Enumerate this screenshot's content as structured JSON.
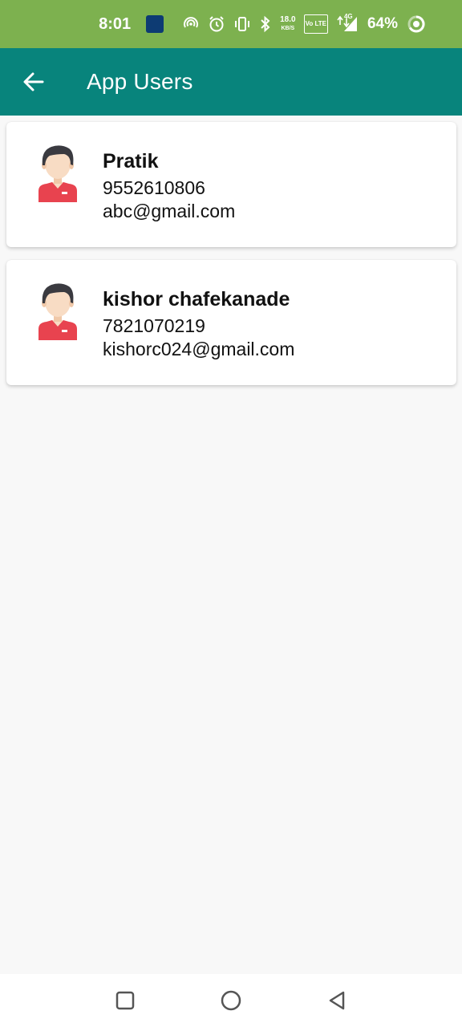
{
  "status_bar": {
    "time": "8:01",
    "net_speed_value": "18.0",
    "net_speed_unit": "KB/S",
    "volte_label": "Vo LTE",
    "network_type": "4G",
    "battery_percent": "64%",
    "battery_level": 0.64
  },
  "app_bar": {
    "title": "App Users",
    "back_icon": "arrow-left-icon"
  },
  "users": [
    {
      "name": "Pratik",
      "phone": "9552610806",
      "email": "abc@gmail.com",
      "avatar_icon": "user-avatar-icon"
    },
    {
      "name": "kishor chafekanade",
      "phone": "7821070219",
      "email": "kishorc024@gmail.com",
      "avatar_icon": "user-avatar-icon"
    }
  ],
  "nav_bar": {
    "buttons": [
      "recents-square-icon",
      "home-circle-icon",
      "back-triangle-icon"
    ]
  },
  "colors": {
    "status_bar": "#7db14f",
    "app_bar": "#08847c",
    "background": "#f8f8f8",
    "card": "#ffffff",
    "avatar_shirt": "#e8434f",
    "avatar_hair": "#3a3a40",
    "avatar_skin": "#f8dcc4"
  }
}
